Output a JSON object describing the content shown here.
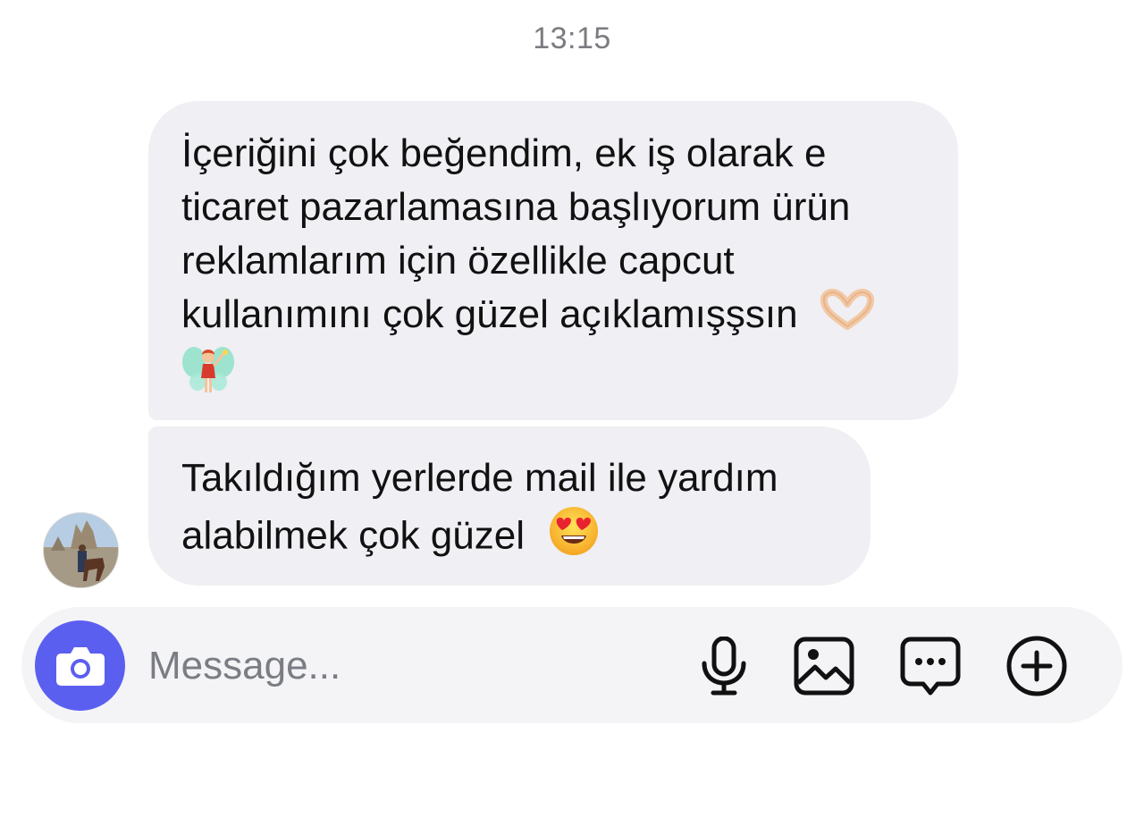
{
  "chat": {
    "timestamp": "13:15",
    "messages": [
      {
        "lines": [
          "İçeriğini çok beğendim, ek iş olarak e",
          "ticaret pazarlamasına başlıyorum ürün",
          "reklamlarım için özellikle capcut",
          "kullanımını çok güzel açıklamışşsın"
        ],
        "emojis": [
          "heart-hands-emoji",
          "fairy-emoji"
        ]
      },
      {
        "lines": [
          "Takıldığım yerlerde mail ile yardım",
          "alabilmek çok güzel"
        ],
        "emojis": [
          "heart-eyes-emoji"
        ]
      }
    ]
  },
  "composer": {
    "placeholder": "Message...",
    "value": "",
    "icons": [
      "camera-icon",
      "microphone-icon",
      "gallery-icon",
      "sticker-icon",
      "plus-icon"
    ],
    "accent_color": "#5b5ff0"
  }
}
